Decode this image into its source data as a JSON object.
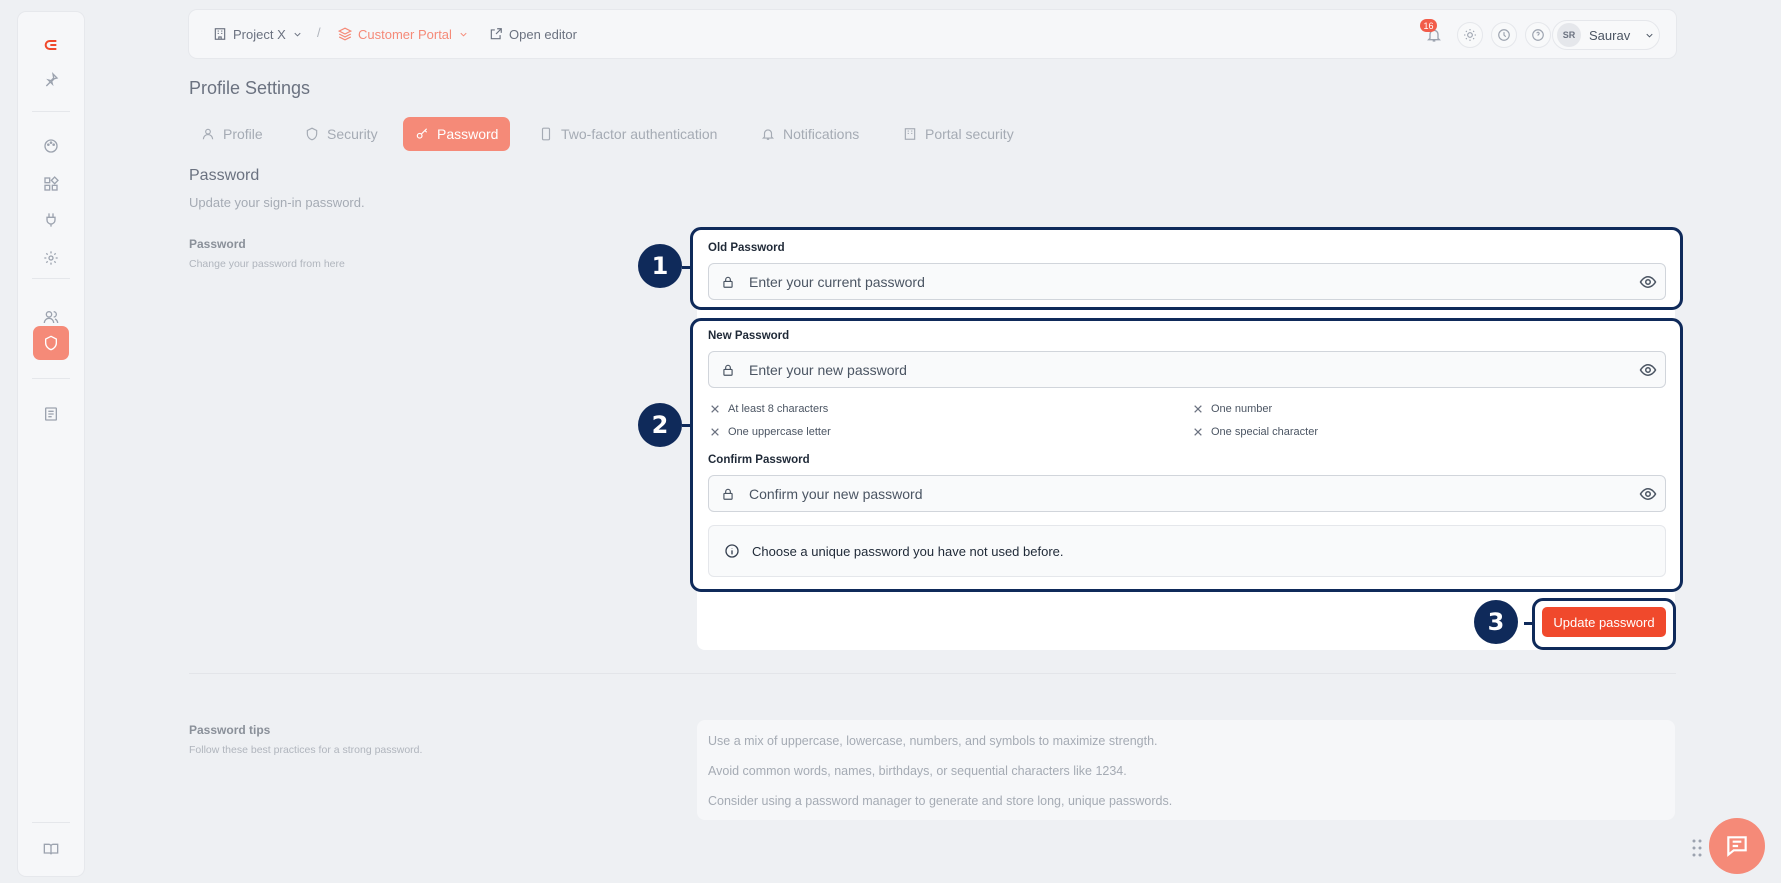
{
  "topbar": {
    "project": "Project X",
    "separator": "/",
    "portal": "Customer Portal",
    "open_editor": "Open editor",
    "notifications_count": "16",
    "user_initials": "SR",
    "user_name": "Saurav"
  },
  "page": {
    "title": "Profile Settings"
  },
  "tabs": [
    {
      "label": "Profile"
    },
    {
      "label": "Security"
    },
    {
      "label": "Password"
    },
    {
      "label": "Two-factor authentication"
    },
    {
      "label": "Notifications"
    },
    {
      "label": "Portal security"
    }
  ],
  "section": {
    "title": "Password",
    "subtitle": "Update your sign-in password.",
    "label": "Password",
    "desc": "Change your password from here"
  },
  "form": {
    "old_label": "Old Password",
    "old_placeholder": "Enter your current password",
    "new_label": "New Password",
    "new_placeholder": "Enter your new password",
    "requirements": [
      "At least 8 characters",
      "One number",
      "One uppercase letter",
      "One special character"
    ],
    "confirm_label": "Confirm Password",
    "confirm_placeholder": "Confirm your new password",
    "info": "Choose a unique password you have not used before.",
    "submit": "Update password"
  },
  "annotations": [
    "1",
    "2",
    "3"
  ],
  "tips": {
    "label": "Password tips",
    "desc": "Follow these best practices for a strong password.",
    "items": [
      "Use a mix of uppercase, lowercase, numbers, and symbols to maximize strength.",
      "Avoid common words, names, birthdays, or sequential characters like 1234.",
      "Consider using a password manager to generate and store long, unique passwords."
    ]
  },
  "colors": {
    "accent": "#f0492c",
    "accent_soft": "#f58a78",
    "annotation": "#0f2a5a"
  },
  "icons": [
    "logo-icon",
    "pin-icon",
    "palette-icon",
    "widgets-icon",
    "plug-icon",
    "gear-icon",
    "users-icon",
    "shield-icon",
    "document-icon",
    "book-icon",
    "building-icon",
    "layers-icon",
    "external-link-icon",
    "bell-icon",
    "sun-icon",
    "history-icon",
    "help-icon",
    "lock-icon",
    "eye-icon",
    "x-icon",
    "info-icon",
    "chat-icon"
  ]
}
